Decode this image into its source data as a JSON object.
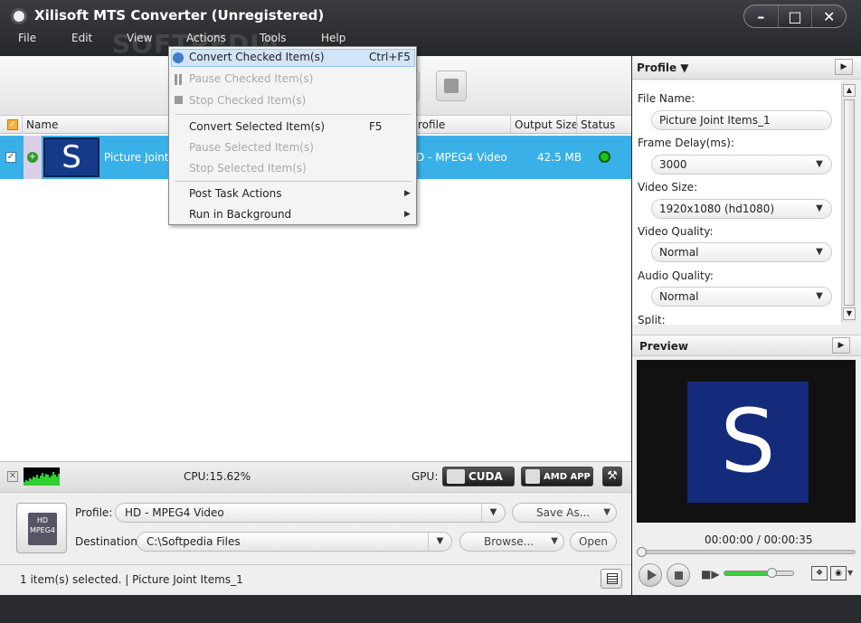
{
  "window": {
    "title": "Xilisoft MTS Converter (Unregistered)"
  },
  "menubar": [
    "File",
    "Edit",
    "View",
    "Actions",
    "Tools",
    "Help"
  ],
  "watermark": "SOFTPEDIA",
  "actions_menu": {
    "items": [
      {
        "label": "Convert Checked Item(s)",
        "shortcut": "Ctrl+F5",
        "enabled": true,
        "highlighted": true
      },
      {
        "label": "Pause Checked Item(s)",
        "shortcut": "",
        "enabled": false
      },
      {
        "label": "Stop Checked Item(s)",
        "shortcut": "",
        "enabled": false
      },
      {
        "label": "Convert Selected Item(s)",
        "shortcut": "F5",
        "enabled": true
      },
      {
        "label": "Pause Selected Item(s)",
        "shortcut": "",
        "enabled": false
      },
      {
        "label": "Stop Selected Item(s)",
        "shortcut": "",
        "enabled": false
      },
      {
        "label": "Post Task Actions",
        "shortcut": "",
        "enabled": true,
        "submenu": true
      },
      {
        "label": "Run in Background",
        "shortcut": "",
        "enabled": true,
        "submenu": true
      }
    ]
  },
  "file_list": {
    "columns": [
      "Name",
      "rofile",
      "Output Size",
      "Status"
    ],
    "rows": [
      {
        "thumb_letter": "S",
        "name": "Picture Joint I",
        "profile": "D - MPEG4 Video",
        "output_size": "42.5 MB",
        "checked": true,
        "status_color": "#18c818"
      }
    ]
  },
  "cpu": {
    "label": "CPU:15.62%"
  },
  "gpu": {
    "label": "GPU:",
    "cuda": "CUDA",
    "amd": "AMD APP"
  },
  "profile_bar": {
    "profile_label": "Profile:",
    "profile_value": "HD - MPEG4 Video",
    "save_as": "Save As...",
    "destination_label": "Destination:",
    "destination_value": "C:\\Softpedia Files",
    "browse": "Browse...",
    "open": "Open",
    "icon_text_top": "HD",
    "icon_text_bottom": "MPEG4"
  },
  "statusbar": {
    "text": "1 item(s) selected. | Picture Joint Items_1"
  },
  "profile_panel": {
    "title": "Profile",
    "fields": [
      {
        "label": "File Name:",
        "value": "Picture Joint Items_1",
        "dropdown": false
      },
      {
        "label": "Frame Delay(ms):",
        "value": "3000",
        "dropdown": true
      },
      {
        "label": "Video Size:",
        "value": "1920x1080 (hd1080)",
        "dropdown": true
      },
      {
        "label": "Video Quality:",
        "value": "Normal",
        "dropdown": true
      },
      {
        "label": "Audio Quality:",
        "value": "Normal",
        "dropdown": true
      },
      {
        "label": "Split:",
        "value": "",
        "dropdown": false
      }
    ]
  },
  "preview": {
    "title": "Preview",
    "letter": "S",
    "timecode": "00:00:00 / 00:00:35",
    "seek_position": 0.0,
    "volume_level": 0.7
  }
}
